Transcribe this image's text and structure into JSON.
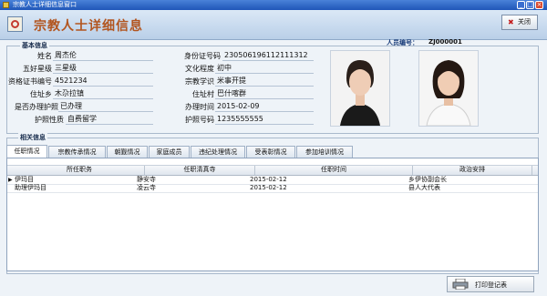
{
  "window": {
    "title": "宗教人士详细信息窗口"
  },
  "header": {
    "title": "宗教人士详细信息",
    "close_label": "关闭",
    "close_icon": "close-x-icon"
  },
  "staff": {
    "number_label": "人员编号：",
    "number_value": "ZJ000001"
  },
  "basic": {
    "title": "基本信息",
    "fields": {
      "name": {
        "label": "姓名",
        "value": "周杰伦"
      },
      "stars": {
        "label": "五好星级",
        "value": "三星级"
      },
      "cert_no": {
        "label": "资格证书编号",
        "value": "4521234"
      },
      "township": {
        "label": "住址乡",
        "value": "木尕拉镇"
      },
      "license_done": {
        "label": "是否办理护照",
        "value": "已办理"
      },
      "passport_type": {
        "label": "护照性质",
        "value": "自费留学"
      },
      "id_no": {
        "label": "身份证号码",
        "value": "230506196112111312"
      },
      "education": {
        "label": "文化程度",
        "value": "初中"
      },
      "religious_knowledge": {
        "label": "宗教学识",
        "value": "米事开提"
      },
      "village": {
        "label": "住址村",
        "value": "巴什喀群"
      },
      "apply_date": {
        "label": "办理时间",
        "value": "2015-02-09"
      },
      "passport_no": {
        "label": "护照号码",
        "value": "1235555555"
      }
    }
  },
  "related": {
    "title": "相关信息",
    "tabs": [
      "任职情况",
      "宗教传承情况",
      "朝觐情况",
      "家庭成员",
      "违纪处理情况",
      "受表彰情况",
      "参加培训情况"
    ],
    "active_tab": 0,
    "grid": {
      "columns": [
        "所任职务",
        "任职清真寺",
        "任职时间",
        "政治安排"
      ],
      "rows": [
        [
          "伊玛目",
          "静安寺",
          "2015-02-12",
          "乡伊协副会长"
        ],
        [
          "助理伊玛目",
          "凌云寺",
          "2015-02-12",
          "县人大代表"
        ]
      ],
      "current_row_indicator": "▶"
    }
  },
  "footer": {
    "print_label": "打印登记表"
  },
  "colors": {
    "title_accent": "#b2551f",
    "titlebar": "#1f56b8"
  }
}
